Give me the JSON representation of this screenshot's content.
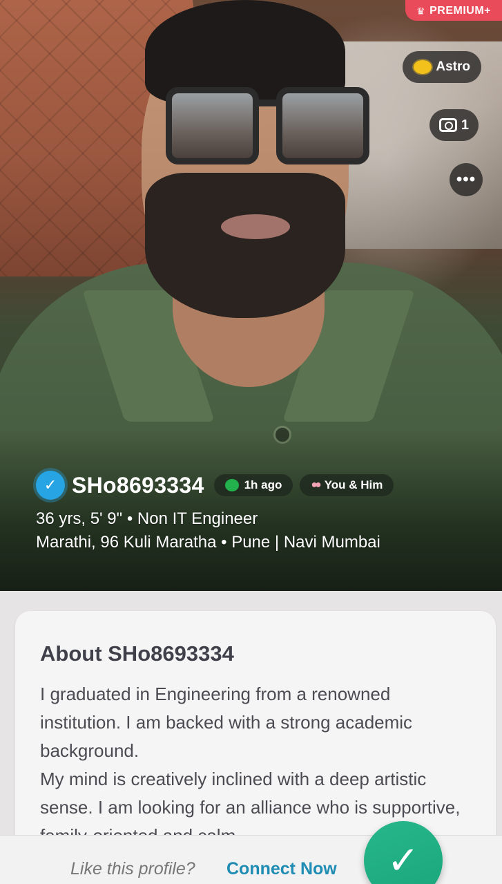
{
  "badges": {
    "premium": "PREMIUM+",
    "astro": "Astro",
    "photo_count": "1",
    "more": "•••"
  },
  "profile": {
    "username": "SHo8693334",
    "last_active": "1h ago",
    "match_tag": "You & Him",
    "line1": "36 yrs, 5' 9\" • Non IT Engineer",
    "line2": "Marathi, 96 Kuli Maratha • Pune | Navi Mumbai"
  },
  "about": {
    "title": "About SHo8693334",
    "paragraphs": [
      "I graduated in Engineering from a renowned institution. I am backed with a strong academic background.",
      "My mind is creatively inclined with a deep artistic sense. I am looking for an alliance who is supportive, family-oriented and calm"
    ]
  },
  "cta": {
    "prompt": "Like this profile?",
    "link": "Connect Now",
    "button_glyph": "✓"
  },
  "colors": {
    "premium": "#ea4b5a",
    "verified": "#27a4e3",
    "connect": "#1f8cb3",
    "accept_button": "#19a67a"
  },
  "icons": [
    "crown-icon",
    "planet-icon",
    "camera-icon",
    "more-icon",
    "verified-icon",
    "chat-icon",
    "people-icon",
    "checkmark-icon"
  ]
}
